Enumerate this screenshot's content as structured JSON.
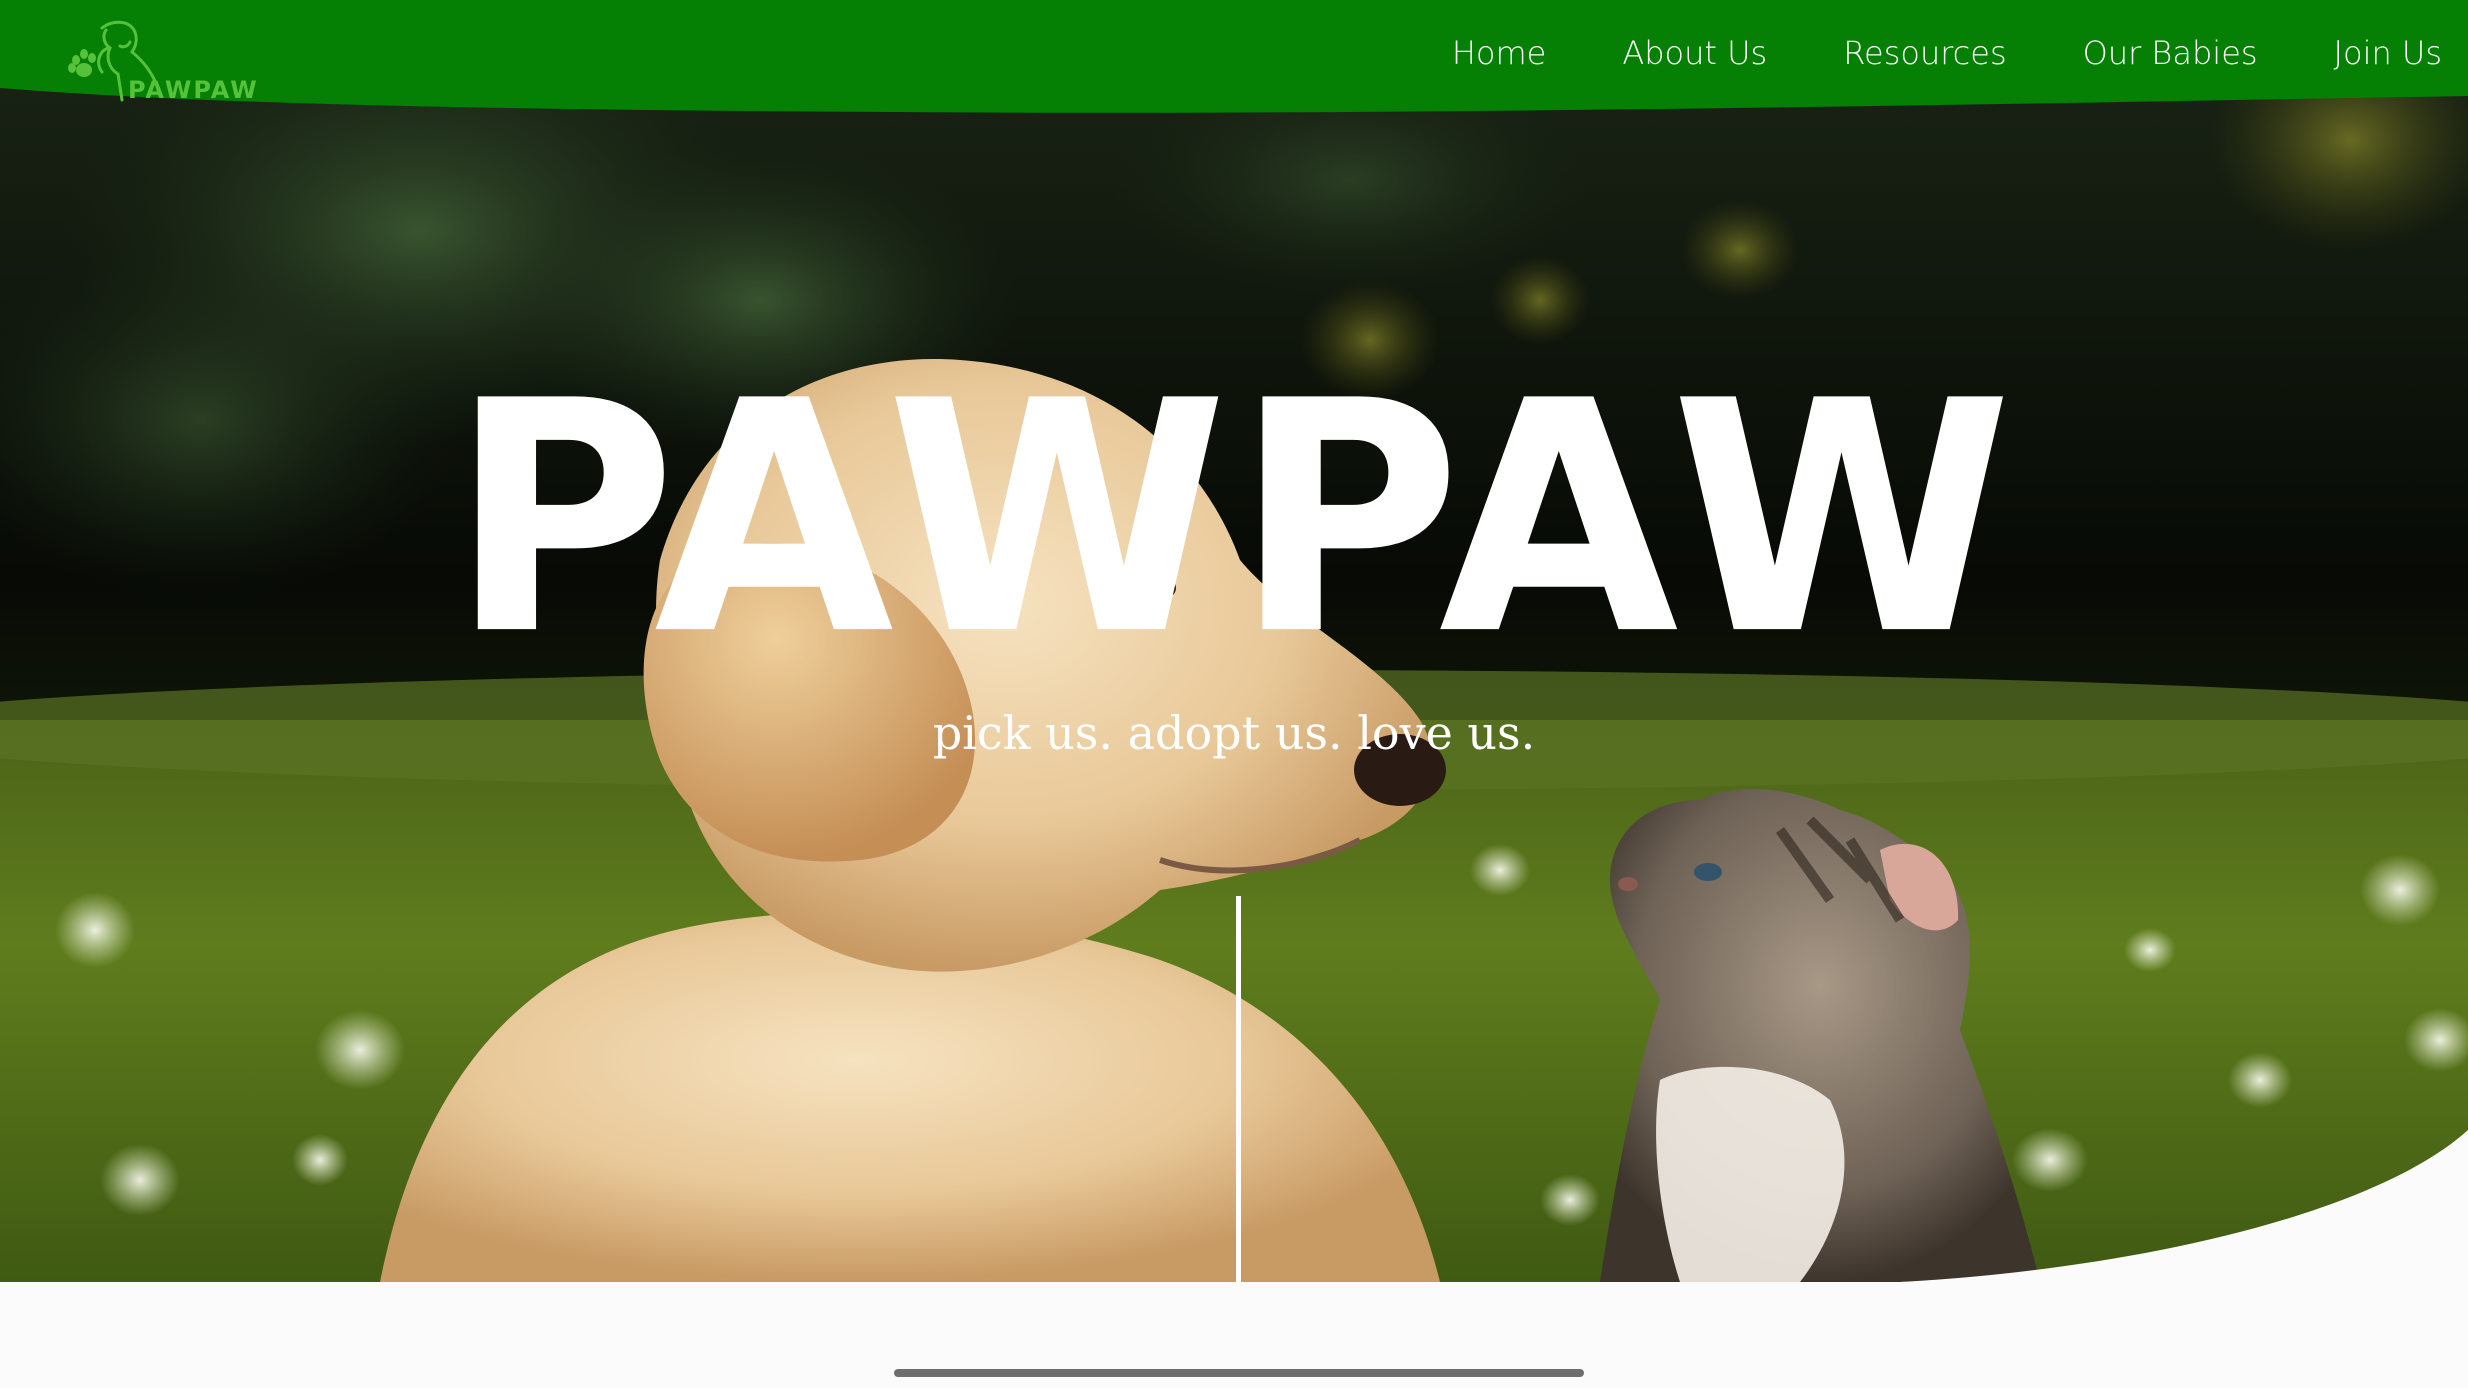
{
  "brand": {
    "logo_text": "PAWPAW",
    "logo_icon": "dog-and-cat-paw-logo-icon",
    "nav_color": "#058005",
    "logo_color": "#56c23a"
  },
  "nav": {
    "items": [
      {
        "label": "Home"
      },
      {
        "label": "About Us"
      },
      {
        "label": "Resources"
      },
      {
        "label": "Our Babies"
      },
      {
        "label": "Join Us"
      }
    ]
  },
  "hero": {
    "title": "PAWPAW",
    "tagline": "pick us. adopt us. love us.",
    "image": "puppy-and-kitten-in-grass-photo"
  }
}
